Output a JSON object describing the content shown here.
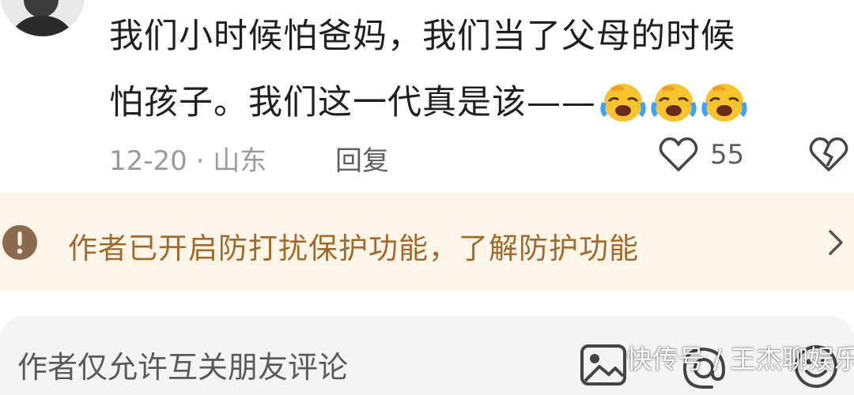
{
  "comment": {
    "text_line1": "我们小时候怕爸妈，我们当了父母的时候",
    "text_line2": "怕孩子。我们这一代真是该——",
    "emoji": "laughing-crying-emoji",
    "emoji_count": 3,
    "date_location": "12-20 · 山东",
    "reply_label": "回复",
    "like_count": "55"
  },
  "notice": {
    "text": "作者已开启防打扰保护功能，了解防护功能",
    "colors": {
      "background": "#fdf6e8",
      "text": "#a16a2c"
    }
  },
  "input_bar": {
    "placeholder": "作者仅允许互关朋友评论"
  },
  "watermark": {
    "text": "快传号 / 王杰聊娱乐"
  },
  "icons": [
    "heart-icon",
    "broken-heart-icon",
    "warning-icon",
    "chevron-right-icon",
    "image-icon",
    "at-icon",
    "emoji-icon"
  ]
}
